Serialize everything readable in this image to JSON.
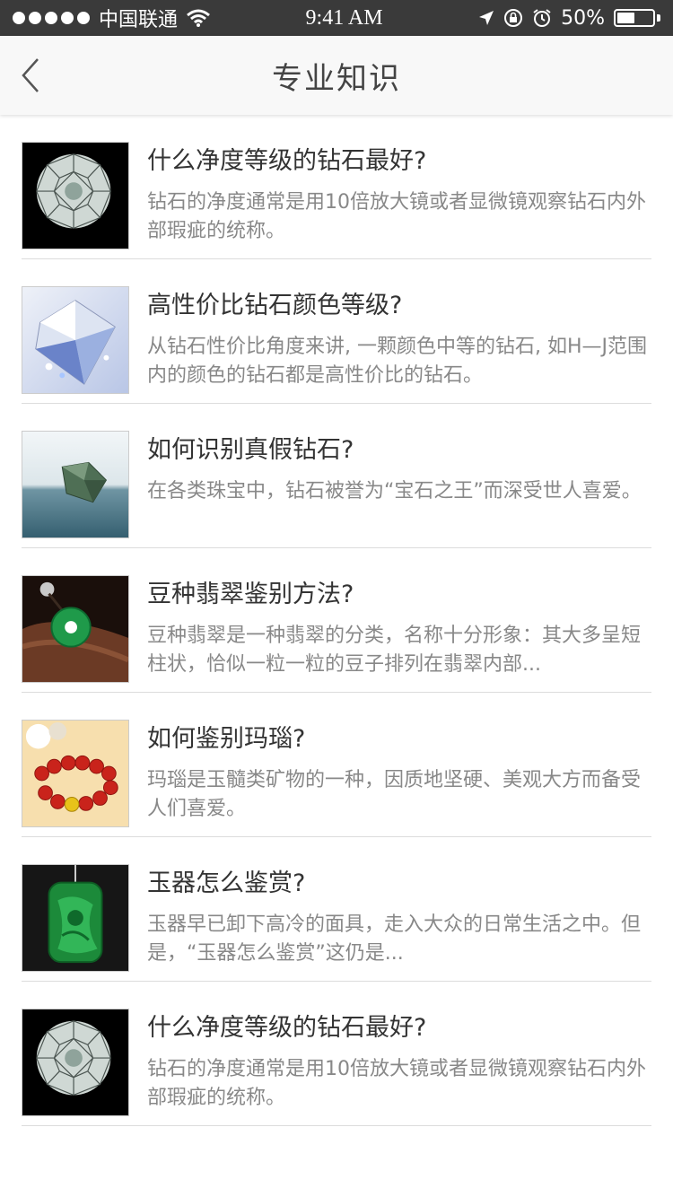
{
  "status": {
    "carrier": "中国联通",
    "time": "9:41 AM",
    "battery": "50%",
    "battery_level": 0.5
  },
  "nav": {
    "title": "专业知识",
    "back_icon": "chevron-left-icon"
  },
  "articles": [
    {
      "thumb": "diamond-black",
      "title": "什么净度等级的钻石最好?",
      "desc": "钻石的净度通常是用10倍放大镜或者显微镜观察钻石内外部瑕疵的统称。"
    },
    {
      "thumb": "diamond-blue",
      "title": "高性价比钻石颜色等级?",
      "desc": "从钻石性价比角度来讲, 一颗颜色中等的钻石, 如H—J范围内的颜色的钻石都是高性价比的钻石。"
    },
    {
      "thumb": "diamond-water",
      "title": "如何识别真假钻石?",
      "desc": "在各类珠宝中，钻石被誉为“宝石之王”而深受世人喜爱。"
    },
    {
      "thumb": "jade-ring",
      "title": "豆种翡翠鉴别方法?",
      "desc": "豆种翡翠是一种翡翠的分类，名称十分形象：其大多呈短柱状，恰似一粒一粒的豆子排列在翡翠内部..."
    },
    {
      "thumb": "agate-bracelet",
      "title": "如何鉴别玛瑙?",
      "desc": "玛瑙是玉髓类矿物的一种，因质地坚硬、美观大方而备受人们喜爱。"
    },
    {
      "thumb": "jade-pendant",
      "title": "玉器怎么鉴赏?",
      "desc": "玉器早已卸下高冷的面具，走入大众的日常生活之中。但是，“玉器怎么鉴赏”这仍是..."
    },
    {
      "thumb": "diamond-black",
      "title": "什么净度等级的钻石最好?",
      "desc": "钻石的净度通常是用10倍放大镜或者显微镜观察钻石内外部瑕疵的统称。"
    }
  ]
}
